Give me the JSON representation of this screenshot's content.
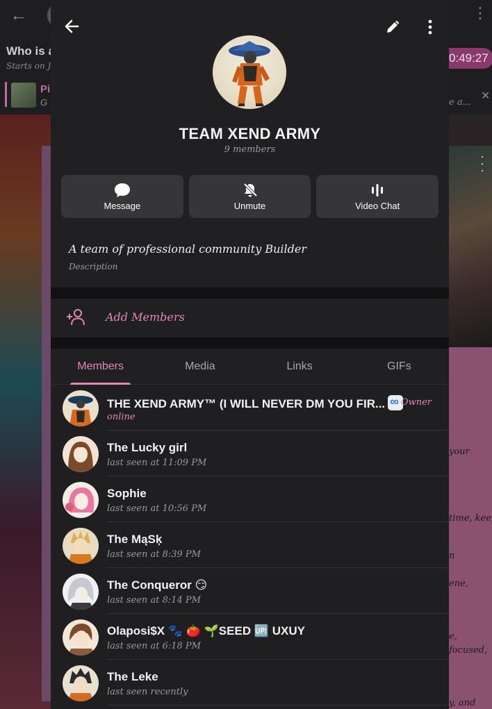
{
  "background": {
    "chat_title": "Who is a",
    "chat_subtitle": "Starts on Ja",
    "timer": "0:49:27",
    "pinned_title": "Pi",
    "pinned_sub": "G",
    "pinned_right": "e a...",
    "right_snippets": [
      "your",
      "time, keep",
      "n",
      "ene,",
      "e,",
      "focused,",
      "y, and"
    ]
  },
  "header": {
    "title": "TEAM XEND ARMY",
    "subtitle": "9 members",
    "actions": [
      {
        "label": "Message",
        "icon": "message-bubble-icon"
      },
      {
        "label": "Unmute",
        "icon": "bell-off-icon"
      },
      {
        "label": "Video Chat",
        "icon": "live-stream-icon"
      }
    ]
  },
  "description": {
    "text": "A team of professional community Builder",
    "label": "Description"
  },
  "add_members": {
    "label": "Add Members"
  },
  "tabs": [
    {
      "label": "Members",
      "active": true
    },
    {
      "label": "Media",
      "active": false
    },
    {
      "label": "Links",
      "active": false
    },
    {
      "label": "GIFs",
      "active": false
    }
  ],
  "members": [
    {
      "name": "THE XEND ARMY™ (I WILL NEVER DM YOU FIR...",
      "status": "online",
      "role": "Owner",
      "online": true,
      "avatar_colors": [
        "#1a3a5a",
        "#d86a20"
      ]
    },
    {
      "name": "The Lucky girl",
      "status": "last seen at 11:09 PM",
      "role": "",
      "online": false,
      "avatar_colors": [
        "#f2e4d4",
        "#7a4a2a"
      ]
    },
    {
      "name": "Sophie",
      "status": "last seen at 10:56 PM",
      "role": "",
      "online": false,
      "avatar_colors": [
        "#f4e8e0",
        "#e878a0"
      ]
    },
    {
      "name": "The MąSķ",
      "status": "last seen at 8:39 PM",
      "role": "",
      "online": false,
      "avatar_colors": [
        "#e8d8b8",
        "#d87a20"
      ]
    },
    {
      "name": "The Conqueror 😏",
      "status": "last seen at 8:14 PM",
      "role": "",
      "online": false,
      "avatar_colors": [
        "#f0f0f2",
        "#b8b8c0"
      ]
    },
    {
      "name": "Olaposi$X 🐾 🍅 🌱SEED 🆙 UXUY",
      "status": "last seen at 6:18 PM",
      "role": "",
      "online": false,
      "avatar_colors": [
        "#f2e6d4",
        "#7a4a2a"
      ]
    },
    {
      "name": "The Leke",
      "status": "last seen recently",
      "role": "",
      "online": false,
      "avatar_colors": [
        "#e8e0d0",
        "#3a3a3a"
      ]
    }
  ],
  "colors": {
    "accent": "#e387b4",
    "panel": "#202022",
    "button": "#363638"
  }
}
